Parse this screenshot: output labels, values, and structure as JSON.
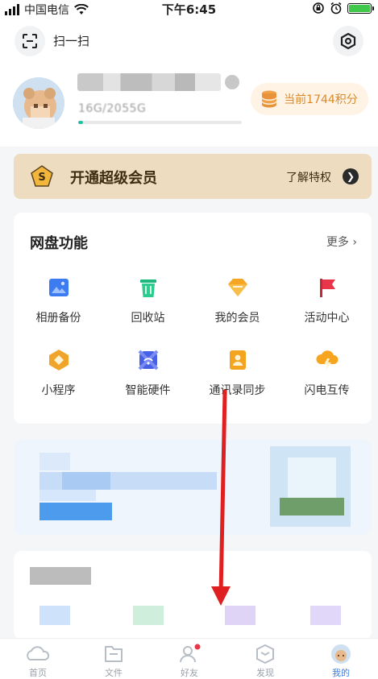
{
  "status_bar": {
    "carrier": "中国电信",
    "time": "下午6:45",
    "battery_level": 1.0
  },
  "header": {
    "scan_label": "扫一扫"
  },
  "profile": {
    "storage_text": "16G/2055G",
    "storage_fraction": 0.03,
    "points_label": "当前1744积分"
  },
  "vip_banner": {
    "title": "开通超级会员",
    "link_label": "了解特权"
  },
  "functions": {
    "title": "网盘功能",
    "more_label": "更多",
    "items": [
      {
        "label": "相册备份",
        "icon": "photo-album-icon",
        "color": "#3d7cf0"
      },
      {
        "label": "回收站",
        "icon": "trash-icon",
        "color": "#20b77f"
      },
      {
        "label": "我的会员",
        "icon": "diamond-icon",
        "color": "#f5a623"
      },
      {
        "label": "活动中心",
        "icon": "flag-icon",
        "color": "#e8354a"
      },
      {
        "label": "小程序",
        "icon": "mini-program-icon",
        "color": "#f0a52a"
      },
      {
        "label": "智能硬件",
        "icon": "smart-hardware-icon",
        "color": "#4660e6"
      },
      {
        "label": "通讯录同步",
        "icon": "contacts-sync-icon",
        "color": "#f3a520"
      },
      {
        "label": "闪电互传",
        "icon": "lightning-transfer-icon",
        "color": "#f7a51e"
      }
    ]
  },
  "tab_bar": {
    "tabs": [
      {
        "label": "首页",
        "icon": "home-icon"
      },
      {
        "label": "文件",
        "icon": "folder-icon"
      },
      {
        "label": "好友",
        "icon": "friends-icon"
      },
      {
        "label": "发现",
        "icon": "discover-icon"
      },
      {
        "label": "我的",
        "icon": "profile-icon"
      }
    ],
    "active_index": 4
  },
  "colors": {
    "accent": "#3b7ddd",
    "annotation_arrow": "#e02020",
    "vip_bg": "#eddcbf",
    "points_text": "#d98b2b"
  }
}
